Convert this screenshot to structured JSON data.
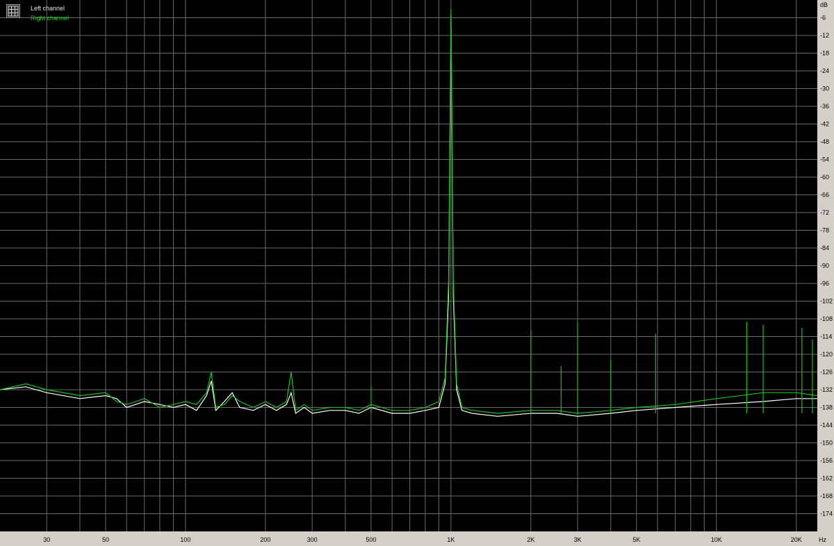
{
  "legend": {
    "icon": "legend-grid-icon",
    "left_channel": "Left channel",
    "right_channel": "Right channel"
  },
  "colors": {
    "background": "#000000",
    "grid": "#6a6a6a",
    "left_channel": "#ffffff",
    "right_channel": "#18c018",
    "axis_panel": "#d4d0c8"
  },
  "chart_data": {
    "type": "line",
    "title": "",
    "xlabel": "",
    "ylabel": "",
    "x_unit": "Hz",
    "y_unit": "dB",
    "x_scale": "log",
    "xlim": [
      20,
      24000
    ],
    "ylim": [
      -180,
      0
    ],
    "grid": true,
    "legend_position": "top-left",
    "x_ticks": [
      {
        "value": 30,
        "label": "30"
      },
      {
        "value": 50,
        "label": "50"
      },
      {
        "value": 100,
        "label": "100"
      },
      {
        "value": 200,
        "label": "200"
      },
      {
        "value": 300,
        "label": "300"
      },
      {
        "value": 500,
        "label": "500"
      },
      {
        "value": 1000,
        "label": "1K"
      },
      {
        "value": 2000,
        "label": "2K"
      },
      {
        "value": 3000,
        "label": "3K"
      },
      {
        "value": 5000,
        "label": "5K"
      },
      {
        "value": 10000,
        "label": "10K"
      },
      {
        "value": 20000,
        "label": "20K"
      }
    ],
    "y_ticks": [
      -6,
      -12,
      -18,
      -24,
      -30,
      -36,
      -42,
      -48,
      -54,
      -60,
      -66,
      -72,
      -78,
      -84,
      -90,
      -96,
      -102,
      -108,
      -114,
      -120,
      -126,
      -132,
      -138,
      -144,
      -150,
      -156,
      -162,
      -168,
      -174
    ],
    "series": [
      {
        "name": "Left channel",
        "color": "#ffffff",
        "x": [
          20,
          25,
          30,
          40,
          50,
          55,
          60,
          70,
          80,
          90,
          100,
          110,
          120,
          125,
          130,
          140,
          150,
          160,
          180,
          200,
          220,
          240,
          250,
          260,
          280,
          300,
          350,
          400,
          450,
          500,
          600,
          700,
          800,
          900,
          950,
          980,
          1000,
          1020,
          1050,
          1100,
          1200,
          1500,
          2000,
          2500,
          3000,
          4000,
          5000,
          7000,
          10000,
          15000,
          20000,
          24000
        ],
        "y": [
          -132,
          -131,
          -133,
          -135,
          -134,
          -135,
          -138,
          -136,
          -137,
          -138,
          -137,
          -139,
          -134,
          -129,
          -139,
          -136,
          -133,
          -138,
          -139,
          -137,
          -139,
          -137,
          -133,
          -140,
          -138,
          -140,
          -139,
          -139,
          -140,
          -138,
          -140,
          -140,
          -139,
          -138,
          -130,
          -100,
          -5,
          -100,
          -132,
          -139,
          -140,
          -141,
          -140,
          -140,
          -141,
          -140,
          -139,
          -138,
          -137,
          -136,
          -135,
          -135
        ]
      },
      {
        "name": "Right channel",
        "color": "#18c018",
        "x": [
          20,
          25,
          30,
          40,
          50,
          55,
          60,
          70,
          80,
          90,
          100,
          110,
          120,
          125,
          130,
          140,
          150,
          160,
          180,
          200,
          220,
          240,
          250,
          260,
          280,
          300,
          350,
          400,
          450,
          500,
          600,
          700,
          800,
          900,
          950,
          980,
          1000,
          1020,
          1050,
          1100,
          1200,
          1500,
          2000,
          2500,
          3000,
          4000,
          5000,
          7000,
          10000,
          15000,
          20000,
          24000
        ],
        "y": [
          -132,
          -130,
          -132,
          -134,
          -133,
          -136,
          -137,
          -135,
          -138,
          -137,
          -136,
          -137,
          -133,
          -126,
          -138,
          -137,
          -134,
          -136,
          -138,
          -136,
          -138,
          -136,
          -126,
          -139,
          -137,
          -139,
          -138,
          -138,
          -139,
          -137,
          -139,
          -139,
          -138,
          -136,
          -128,
          -95,
          -3,
          -95,
          -130,
          -138,
          -139,
          -140,
          -139,
          -139,
          -140,
          -139,
          -138,
          -137,
          -135,
          -133,
          -133,
          -134
        ]
      }
    ],
    "spikes": [
      {
        "x": 2000,
        "y": -112,
        "series": "Right channel"
      },
      {
        "x": 3000,
        "y": -109,
        "series": "Right channel"
      },
      {
        "x": 2600,
        "y": -124,
        "series": "Right channel"
      },
      {
        "x": 5900,
        "y": -113,
        "series": "Right channel"
      },
      {
        "x": 13000,
        "y": -109,
        "series": "Right channel"
      },
      {
        "x": 15000,
        "y": -110,
        "series": "Right channel"
      },
      {
        "x": 21000,
        "y": -111,
        "series": "Right channel"
      },
      {
        "x": 23000,
        "y": -115,
        "series": "Right channel"
      },
      {
        "x": 4000,
        "y": -122,
        "series": "Right channel"
      },
      {
        "x": 500,
        "y": -131,
        "series": "Right channel"
      }
    ]
  }
}
